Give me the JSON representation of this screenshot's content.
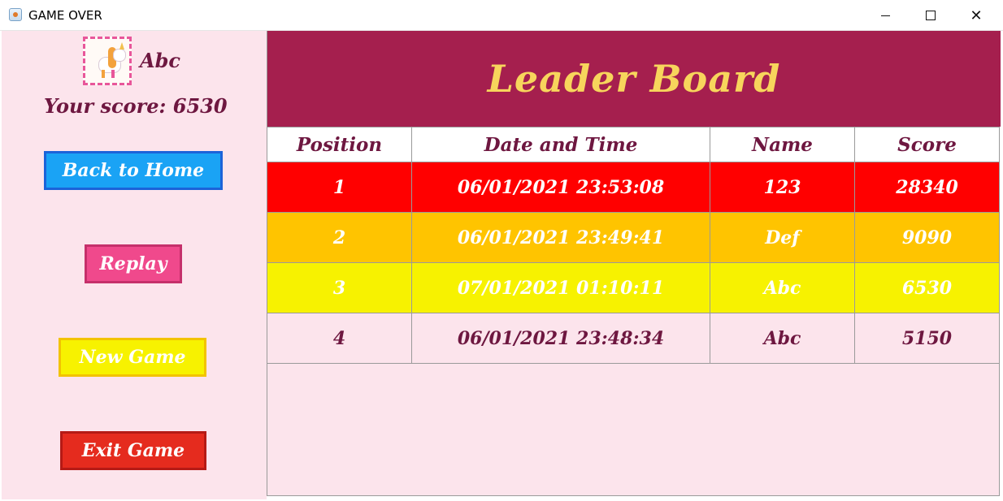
{
  "window": {
    "title": "GAME OVER"
  },
  "player": {
    "name": "Abc",
    "score_text": "Your score: 6530"
  },
  "buttons": {
    "back_home": "Back to Home",
    "replay": "Replay",
    "new_game": "New Game",
    "exit_game": "Exit Game"
  },
  "leaderboard": {
    "title": "Leader Board",
    "headers": [
      "Position",
      "Date and Time",
      "Name",
      "Score"
    ],
    "rows": [
      {
        "position": "1",
        "datetime": "06/01/2021 23:53:08",
        "name": "123",
        "score": "28340",
        "bg": "#ff0000",
        "fg": "#ffffff"
      },
      {
        "position": "2",
        "datetime": "06/01/2021 23:49:41",
        "name": "Def",
        "score": "9090",
        "bg": "#ffc400",
        "fg": "#ffffff"
      },
      {
        "position": "3",
        "datetime": "07/01/2021 01:10:11",
        "name": "Abc",
        "score": "6530",
        "bg": "#f7f200",
        "fg": "#ffffff"
      },
      {
        "position": "4",
        "datetime": "06/01/2021 23:48:34",
        "name": "Abc",
        "score": "5150",
        "bg": "#fce4ec",
        "fg": "#6e1740"
      }
    ]
  },
  "colors": {
    "banner": "#a51f4e",
    "title_gold": "#f7d55c",
    "panel_pink": "#fce4ec",
    "text_maroon": "#6e1740"
  }
}
